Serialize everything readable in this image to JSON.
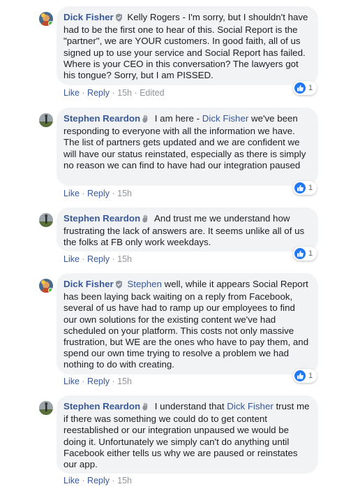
{
  "comments": [
    {
      "author": "Dick Fisher",
      "author_badge": "shield-icon",
      "body": [
        {
          "type": "text",
          "text": " Kelly Rogers - I'm sorry, but I shouldn't have had to be the first one to hear of this. Social Report is the \"partner\", we are YOUR customers. In good faith, all of us signed up to use your service and Social Report has failed. Where is your CEO in this conversation? The lawyers got his tongue? Sorry, but I am PISSED."
        }
      ],
      "actions": {
        "like": "Like",
        "reply": "Reply",
        "time": "15h",
        "edited": "Edited"
      },
      "reaction_count": "1"
    },
    {
      "author": "Stephen Reardon",
      "author_badge": "wave-hand-icon",
      "body": [
        {
          "type": "text",
          "text": " I am here - "
        },
        {
          "type": "mention",
          "text": "Dick Fisher"
        },
        {
          "type": "text",
          "text": " we've been responding to everyone with all the information we have. The list of partners gets updated and we are confident we will have our status reinstated, especially as there is simply no reason we can find to have had our integration paused"
        }
      ],
      "actions": {
        "like": "Like",
        "reply": "Reply",
        "time": "15h"
      },
      "reaction_count": "1"
    },
    {
      "author": "Stephen Reardon",
      "author_badge": "wave-hand-icon",
      "body": [
        {
          "type": "text",
          "text": " And trust me we understand how frustrating the lack of answers are. It seems unlike all of us the folks at FB only work weekdays."
        }
      ],
      "actions": {
        "like": "Like",
        "reply": "Reply",
        "time": "15h"
      },
      "reaction_count": "1"
    },
    {
      "author": "Dick Fisher",
      "author_badge": "shield-icon",
      "body": [
        {
          "type": "mention",
          "text": " Stephen"
        },
        {
          "type": "text",
          "text": " well, while it appears Social Report has been laying back waiting on a reply from Facebook, several of us have had to ramp up our employees to find our own solutions for the existing content we've had scheduled on your platform. This costs not only massive frustration, but WE are the ones who have to pay them, and spend our own time trying to resolve a problem we had nothing to do with creating."
        }
      ],
      "actions": {
        "like": "Like",
        "reply": "Reply",
        "time": "15h"
      },
      "reaction_count": "1"
    },
    {
      "author": "Stephen Reardon",
      "author_badge": "wave-hand-icon",
      "body": [
        {
          "type": "text",
          "text": " I understand that "
        },
        {
          "type": "mention",
          "text": "Dick Fisher"
        },
        {
          "type": "text",
          "text": " trust me if there was something we could do to get content reestablished or our integration unpaused we would be doing it. Unfortunately we simply can't do anything until Facebook either tells us why we are paused or reinstates our app."
        }
      ],
      "actions": {
        "like": "Like",
        "reply": "Reply",
        "time": "15h"
      }
    }
  ],
  "colors": {
    "link": "#385898",
    "bubble": "#f2f3f5",
    "meta": "#90949c",
    "like_blue": "#2078f4"
  }
}
